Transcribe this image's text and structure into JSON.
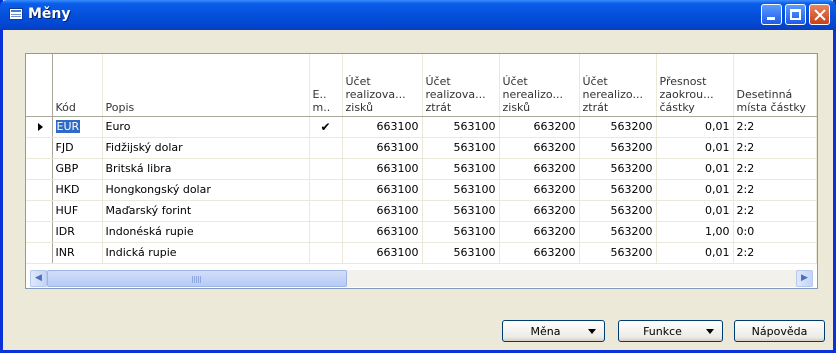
{
  "window": {
    "title": "Měny"
  },
  "columns": {
    "code": "Kód",
    "desc": "Popis",
    "em": "E.. m..",
    "c1": "Účet realizova... zisků",
    "c2": "Účet realizova... ztrát",
    "c3": "Účet nerealizo... zisků",
    "c4": "Účet nerealizo... ztrát",
    "c5": "Přesnost zaokrou... částky",
    "c6": "Desetinná místa částky"
  },
  "rows": [
    {
      "code": "EUR",
      "desc": "Euro",
      "em": "✔",
      "c1": "663100",
      "c2": "563100",
      "c3": "663200",
      "c4": "563200",
      "c5": "0,01",
      "c6": "2:2"
    },
    {
      "code": "FJD",
      "desc": "Fidžijský dolar",
      "em": "",
      "c1": "663100",
      "c2": "563100",
      "c3": "663200",
      "c4": "563200",
      "c5": "0,01",
      "c6": "2:2"
    },
    {
      "code": "GBP",
      "desc": "Britská libra",
      "em": "",
      "c1": "663100",
      "c2": "563100",
      "c3": "663200",
      "c4": "563200",
      "c5": "0,01",
      "c6": "2:2"
    },
    {
      "code": "HKD",
      "desc": "Hongkongský dolar",
      "em": "",
      "c1": "663100",
      "c2": "563100",
      "c3": "663200",
      "c4": "563200",
      "c5": "0,01",
      "c6": "2:2"
    },
    {
      "code": "HUF",
      "desc": "Maďarský forint",
      "em": "",
      "c1": "663100",
      "c2": "563100",
      "c3": "663200",
      "c4": "563200",
      "c5": "0,01",
      "c6": "2:2"
    },
    {
      "code": "IDR",
      "desc": "Indonéská rupie",
      "em": "",
      "c1": "663100",
      "c2": "563100",
      "c3": "663200",
      "c4": "563200",
      "c5": "1,00",
      "c6": "0:0"
    },
    {
      "code": "INR",
      "desc": "Indická rupie",
      "em": "",
      "c1": "663100",
      "c2": "563100",
      "c3": "663200",
      "c4": "563200",
      "c5": "0,01",
      "c6": "2:2"
    }
  ],
  "buttons": {
    "mena": "Měna",
    "funkce": "Funkce",
    "napoveda": "Nápověda"
  }
}
